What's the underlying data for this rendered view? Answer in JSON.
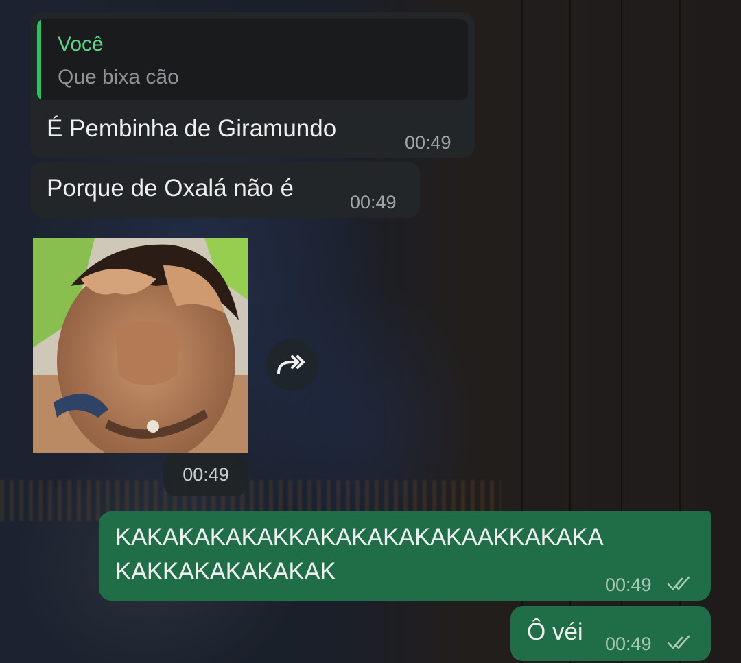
{
  "messages": {
    "m1": {
      "quote_author": "Você",
      "quote_text": "Que bixa cão",
      "text": "É Pembinha de Giramundo",
      "time": "00:49"
    },
    "m2": {
      "text": "Porque de Oxalá não é",
      "time": "00:49"
    },
    "sticker": {
      "time": "00:49"
    },
    "m3": {
      "line1": "KAKAKAKAKAKKAKAKAKAKAKAAKKAKAKA",
      "line2": "KAKKAKAKAKAKAK",
      "time": "00:49",
      "status": "read"
    },
    "m4": {
      "text": "Ô véi",
      "time": "00:49",
      "status": "read"
    }
  },
  "icons": {
    "forward": "forward-icon",
    "read_receipt": "double-check-icon"
  },
  "colors": {
    "incoming_bubble": "#232628",
    "outgoing_bubble": "#1f6e47",
    "quote_accent": "#25c65f",
    "quote_author": "#5fd88c"
  }
}
